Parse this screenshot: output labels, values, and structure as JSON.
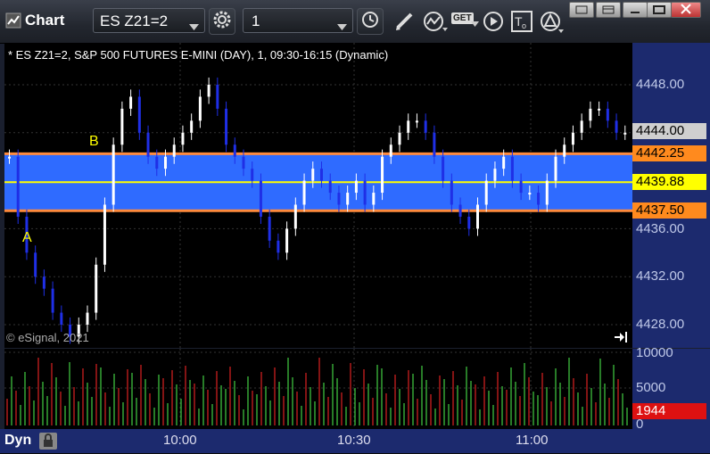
{
  "window": {
    "title": "Chart"
  },
  "toolbar": {
    "symbol": "ES Z21=2",
    "interval": "1",
    "get_label": "GET"
  },
  "chart": {
    "header": "* ES Z21=2, S&P 500 FUTURES E-MINI (DAY), 1, 09:30-16:15 (Dynamic)",
    "copyright": "© eSignal, 2021",
    "marker_a": "A",
    "marker_b": "B"
  },
  "price_axis": {
    "ticks": [
      "4448.00",
      "4436.00",
      "4432.00",
      "4428.00"
    ],
    "last_price": "4444.00",
    "level_upper": "4442.25",
    "level_mid": "4439.88",
    "level_lower": "4437.50"
  },
  "volume_axis": {
    "ticks": [
      "10000",
      "5000",
      "0"
    ],
    "last_volume": "1944"
  },
  "time_axis": {
    "ticks": [
      "10:00",
      "10:30",
      "11:00"
    ],
    "mode": "Dyn"
  },
  "colors": {
    "band_fill": "#2f6bff",
    "band_edge": "#ff8a3c",
    "mid_line": "#ffff00",
    "candle_up": "#ffffff",
    "candle_down": "#1f2fe6",
    "vol_up": "#3fbf3f",
    "vol_down": "#cc2020",
    "label_orange": "#ff8a1e",
    "label_yellow": "#ffff00",
    "label_red": "#dd1111"
  }
}
